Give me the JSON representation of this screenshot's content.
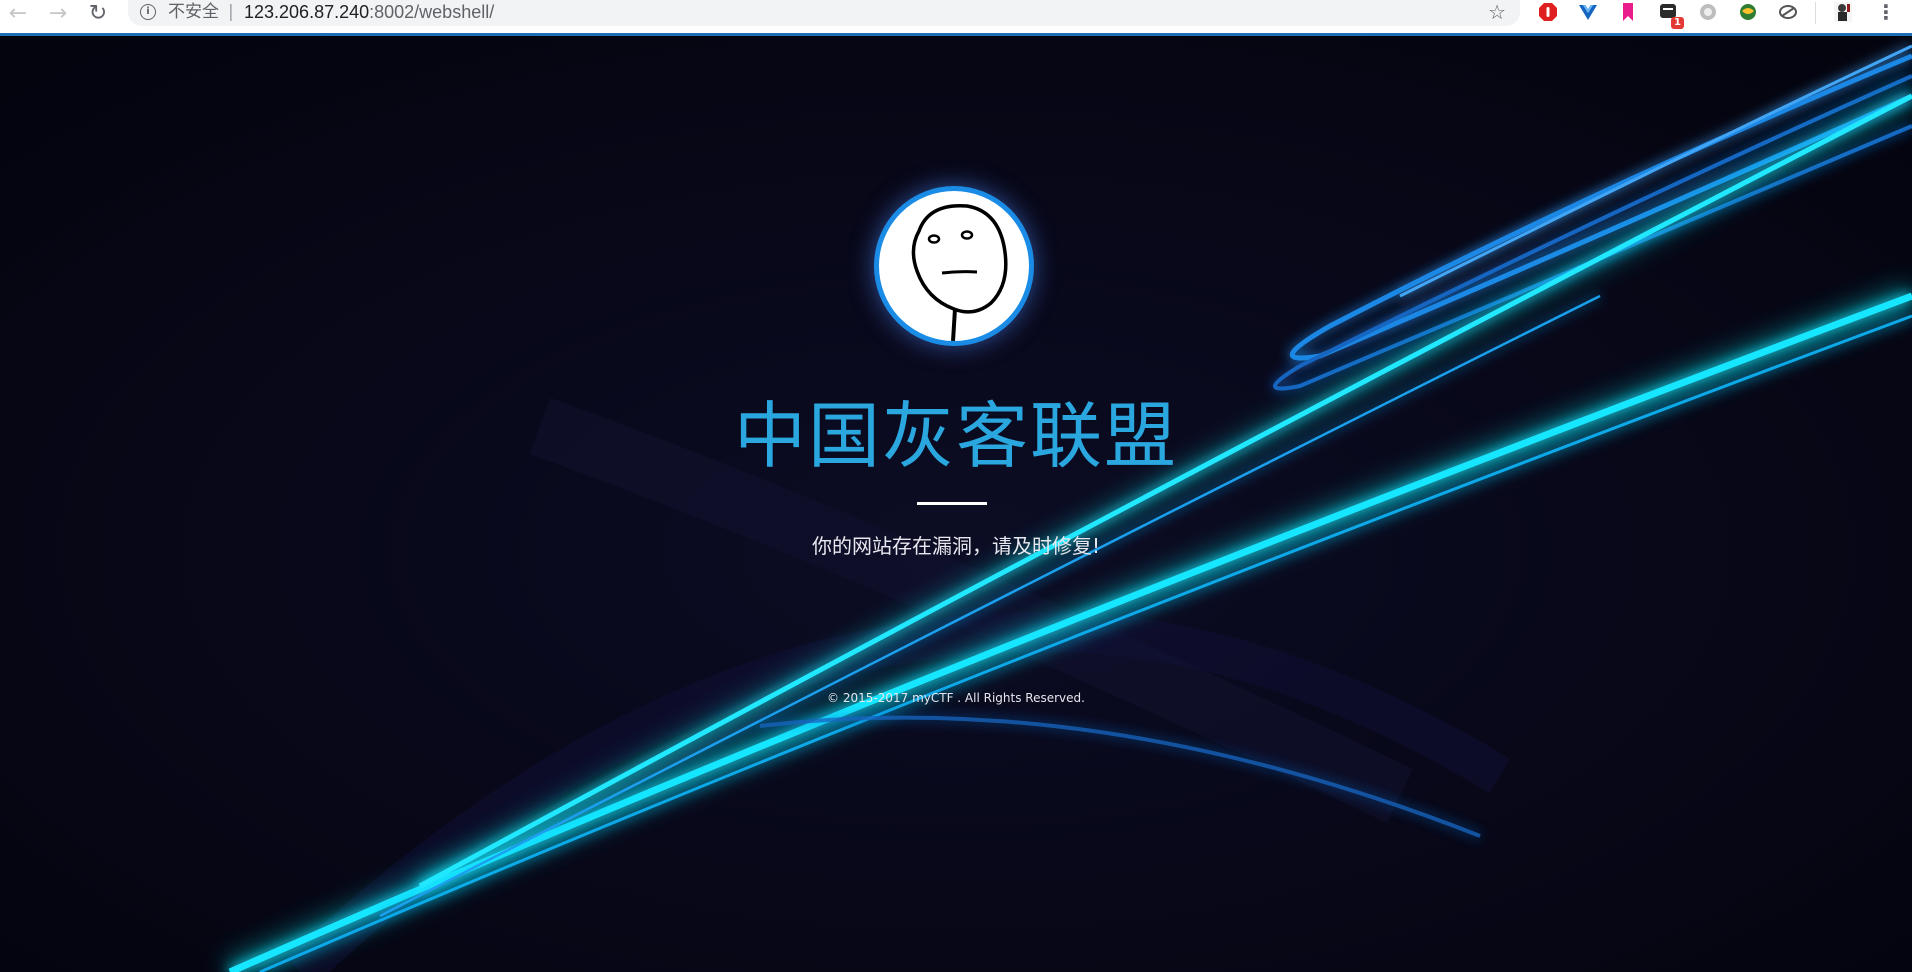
{
  "browser": {
    "security_label": "不安全",
    "separator": "|",
    "url_host": "123.206.87.240",
    "url_rest": ":8002/webshell/",
    "extension_badge": "1"
  },
  "page": {
    "headline": "中国灰客联盟",
    "subtitle": "你的网站存在漏洞，请及时修复!",
    "footer": "© 2015-2017 myCTF . All Rights Reserved."
  },
  "colors": {
    "background": "#06061a",
    "headline": "#2aa7df",
    "avatar_border": "#1a8ce6",
    "light_streak": "#19e6ff"
  },
  "icons": {
    "back": "arrow-left",
    "forward": "arrow-right",
    "reload": "reload",
    "info": "info-circle",
    "bookmark": "star",
    "menu": "vertical-dots"
  }
}
